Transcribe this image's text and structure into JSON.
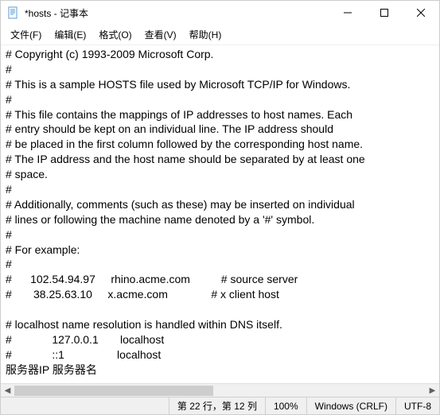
{
  "titlebar": {
    "title": "*hosts - 记事本"
  },
  "menu": {
    "file": "文件(F)",
    "edit": "编辑(E)",
    "format": "格式(O)",
    "view": "查看(V)",
    "help": "帮助(H)"
  },
  "editor": {
    "content": "# Copyright (c) 1993-2009 Microsoft Corp.\n#\n# This is a sample HOSTS file used by Microsoft TCP/IP for Windows.\n#\n# This file contains the mappings of IP addresses to host names. Each\n# entry should be kept on an individual line. The IP address should\n# be placed in the first column followed by the corresponding host name.\n# The IP address and the host name should be separated by at least one\n# space.\n#\n# Additionally, comments (such as these) may be inserted on individual\n# lines or following the machine name denoted by a '#' symbol.\n#\n# For example:\n#\n#      102.54.94.97     rhino.acme.com          # source server\n#       38.25.63.10     x.acme.com              # x client host\n\n# localhost name resolution is handled within DNS itself.\n#             127.0.0.1       localhost\n#             ::1                 localhost\n服务器IP 服务器名"
  },
  "status": {
    "position": "第 22 行，第 12 列",
    "zoom": "100%",
    "line_ending": "Windows (CRLF)",
    "encoding": "UTF-8"
  }
}
